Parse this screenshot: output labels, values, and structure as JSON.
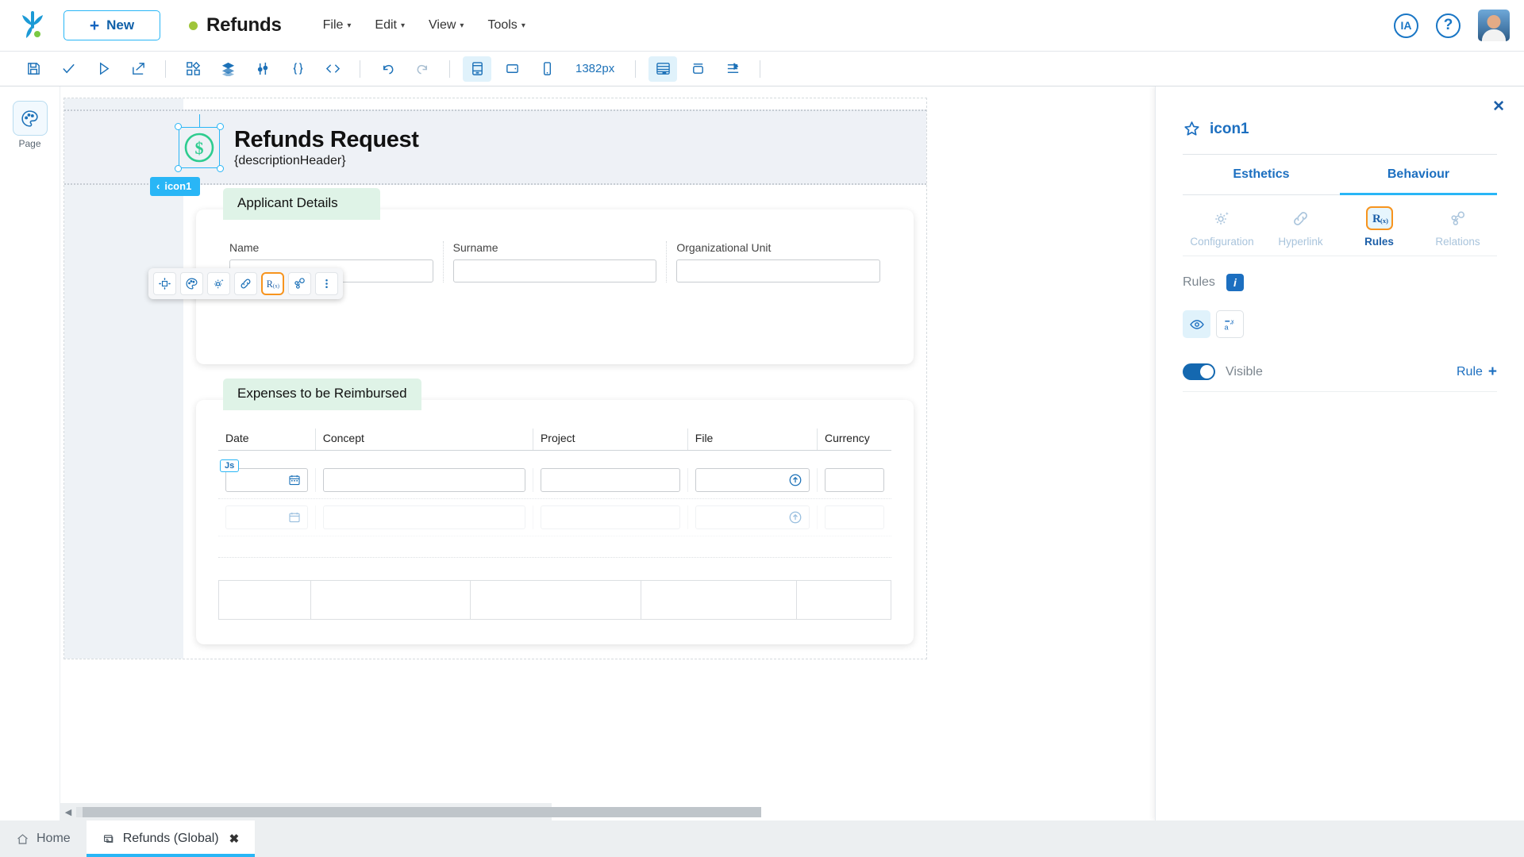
{
  "topbar": {
    "logo_icon": "app-logo-icon",
    "new_button": {
      "label": "New",
      "icon": "plus-icon"
    },
    "document": {
      "name": "Refunds",
      "status_dot_color": "#9fc53a"
    },
    "menus": [
      {
        "label": "File",
        "caret": "▾"
      },
      {
        "label": "Edit",
        "caret": "▾"
      },
      {
        "label": "View",
        "caret": "▾"
      },
      {
        "label": "Tools",
        "caret": "▾"
      }
    ],
    "ia_button": "IA",
    "help_button": "?",
    "avatar": "user-avatar"
  },
  "toolbar": {
    "groups": [
      [
        "save-icon",
        "validate-check-icon",
        "run-play-icon",
        "deploy-export-icon"
      ],
      [
        "components-grid-icon",
        "layers-stack-icon",
        "data-model-icon",
        "expression-braces-icon",
        "source-code-icon"
      ],
      [
        "undo-icon",
        "redo-icon"
      ],
      [
        "desktop-view-icon",
        "tablet-view-icon",
        "mobile-view-icon"
      ],
      [
        "grid-layout-icon",
        "container-icon",
        "align-icon"
      ]
    ],
    "viewport_size": "1382px"
  },
  "left_rail": {
    "items": [
      {
        "label": "Page",
        "icon": "page-palette-icon"
      }
    ]
  },
  "canvas": {
    "selected_element": "icon1",
    "form_header": {
      "icon": "dollar-circle-icon",
      "title": "Refunds Request",
      "subtitle": "{descriptionHeader}",
      "selection_badge": {
        "label": "icon1",
        "back_caret": "‹"
      }
    },
    "float_toolbar": {
      "buttons": [
        {
          "name": "move-icon",
          "selected": false
        },
        {
          "name": "palette-icon",
          "selected": false
        },
        {
          "name": "settings-gear-icon",
          "selected": false
        },
        {
          "name": "hyperlink-icon",
          "selected": false
        },
        {
          "name": "rules-rx-icon",
          "selected": true
        },
        {
          "name": "relations-icon",
          "selected": false
        },
        {
          "name": "more-options-icon",
          "selected": false
        }
      ]
    },
    "sections": [
      {
        "title": "Applicant Details",
        "fields": [
          {
            "label": "Name",
            "value": ""
          },
          {
            "label": "Surname",
            "value": ""
          },
          {
            "label": "Organizational Unit",
            "value": ""
          }
        ]
      },
      {
        "title": "Expenses to be Reimbursed",
        "columns": [
          "Date",
          "Concept",
          "Project",
          "File",
          "Currency"
        ],
        "rows": [
          {
            "js_badge": "Js",
            "date_icon": "calendar-icon",
            "file_icon": "upload-circle-icon",
            "ghost": false
          },
          {
            "js_badge": "",
            "date_icon": "calendar-icon",
            "file_icon": "upload-circle-icon",
            "ghost": true
          }
        ]
      }
    ]
  },
  "right_panel": {
    "close_icon": "close-icon",
    "element": {
      "icon": "star-icon",
      "name": "icon1"
    },
    "tabs": [
      {
        "label": "Esthetics",
        "active": false
      },
      {
        "label": "Behaviour",
        "active": true
      }
    ],
    "subtabs": [
      {
        "label": "Configuration",
        "icon": "settings-gear-icon",
        "active": false
      },
      {
        "label": "Hyperlink",
        "icon": "hyperlink-icon",
        "active": false
      },
      {
        "label": "Rules",
        "icon": "rules-rx-icon",
        "active": true
      },
      {
        "label": "Relations",
        "icon": "relations-icon",
        "active": false
      }
    ],
    "rules": {
      "label": "Rules",
      "info_badge": "i",
      "mode_buttons": [
        {
          "icon": "eye-visibility-icon",
          "active": true
        },
        {
          "icon": "value-expression-icon",
          "active": false
        }
      ],
      "visible_toggle": {
        "label": "Visible",
        "on": true
      },
      "add_rule": {
        "label": "Rule",
        "plus": "+"
      }
    }
  },
  "bottom_tabs": [
    {
      "label": "Home",
      "icon": "home-icon",
      "active": false,
      "closable": false
    },
    {
      "label": "Refunds (Global)",
      "icon": "document-icon",
      "active": true,
      "closable": true,
      "close": "✖"
    }
  ],
  "scrollbar": {
    "left_arrow": "◀",
    "right_arrow": "▶"
  },
  "colors": {
    "accent_blue": "#29b6f6",
    "primary_blue": "#1c6fc0",
    "selection_orange": "#f7941e",
    "section_green": "#dff3e7",
    "status_green": "#9fc53a"
  }
}
